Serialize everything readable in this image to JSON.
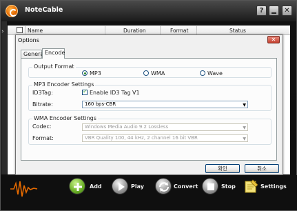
{
  "app": {
    "title": "NoteCable",
    "help_label": "?",
    "close_label": "✕"
  },
  "list": {
    "columns": [
      "Name",
      "Duration",
      "Format",
      "Status"
    ]
  },
  "dialog": {
    "title": "Options",
    "close_label": "✕",
    "tabs": [
      {
        "label": "General",
        "active": false
      },
      {
        "label": "Encode",
        "active": true
      }
    ],
    "output": {
      "title": "Output Format",
      "options": [
        "MP3",
        "WMA",
        "Wave"
      ],
      "selected": "MP3"
    },
    "mp3": {
      "title": "MP3 Encoder Settings",
      "id3_label": "ID3Tag:",
      "id3_checkbox": "Enable ID3 Tag V1",
      "id3_checked": true,
      "bitrate_label": "Bitrate:",
      "bitrate_value": "160 bps-CBR"
    },
    "wma": {
      "title": "WMA Encoder Settings",
      "codec_label": "Codec:",
      "codec_value": "Windows Media Audio 9.2 Lossless",
      "format_label": "Format:",
      "format_value": "VBR Quality 100, 44 kHz, 2 channel 16 bit VBR"
    },
    "ok_label": "확인",
    "cancel_label": "취소"
  },
  "toolbar": {
    "add": "Add",
    "play": "Play",
    "convert": "Convert",
    "stop": "Stop",
    "settings": "Settings"
  },
  "colors": {
    "accent": "#e66a00",
    "toolbar_bg": "#0f0f0f",
    "dialog_bg": "#f0f0f0"
  }
}
